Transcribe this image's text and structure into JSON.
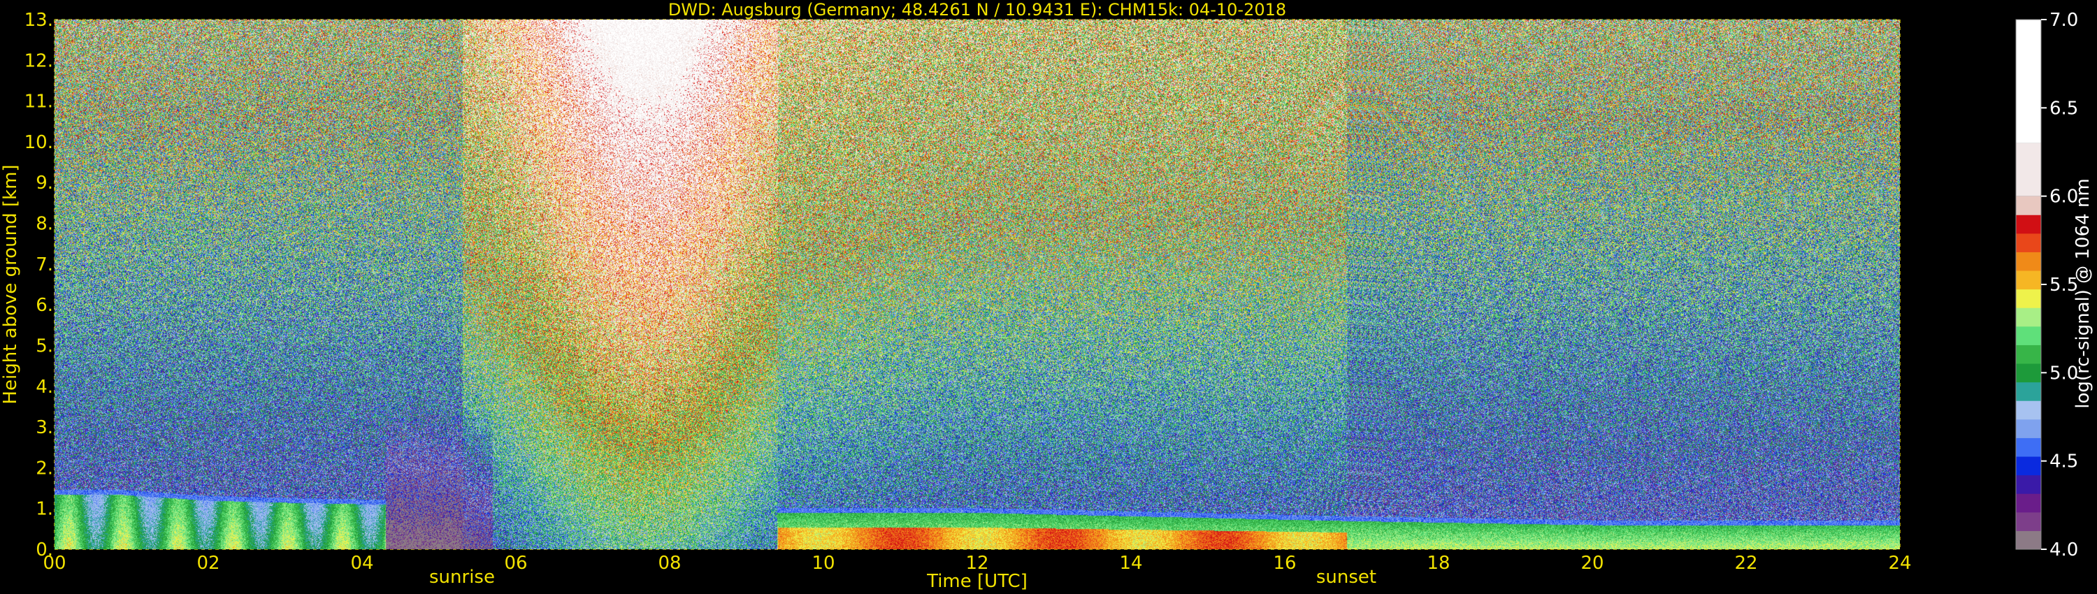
{
  "chart_data": {
    "type": "heatmap",
    "title": "DWD: Augsburg (Germany; 48.4261 N / 10.9431 E):    CHM15k: 04-10-2018",
    "xlabel": "Time [UTC]",
    "ylabel": "Height above ground [km]",
    "xlim": [
      0,
      24
    ],
    "ylim": [
      0,
      13
    ],
    "x_ticks": [
      "00",
      "02",
      "04",
      "06",
      "08",
      "10",
      "12",
      "14",
      "16",
      "18",
      "20",
      "22",
      "24"
    ],
    "y_ticks": [
      "0.",
      "1.",
      "2.",
      "3.",
      "4.",
      "5.",
      "6.",
      "7.",
      "8.",
      "9.",
      "10.",
      "11.",
      "12.",
      "13."
    ],
    "grid": true,
    "sunrise_hour": 5.3,
    "sunset_hour": 16.8,
    "sunrise_label": "sunrise",
    "sunset_label": "sunset",
    "colorbar": {
      "label": "log(rc-signal) @ 1064 nm",
      "range": [
        4.0,
        7.0
      ],
      "tick_labels": [
        "4.0",
        "4.5",
        "5.0",
        "5.5",
        "6.0",
        "6.5",
        "7.0"
      ],
      "colors": [
        "#8c7a86",
        "#7d3e8a",
        "#6a1d8a",
        "#3a1aa8",
        "#0a2adf",
        "#3e6ef5",
        "#7fa2ee",
        "#a7c2f0",
        "#2ba39a",
        "#1d9a3a",
        "#37b548",
        "#5fe07a",
        "#a8ef86",
        "#eef24b",
        "#f6b624",
        "#f08a18",
        "#e9471a",
        "#d10f14",
        "#e8c8c0",
        "#f2e8e8",
        "#ffffff"
      ]
    },
    "boundary_layer": [
      {
        "hour": 0.0,
        "top_km": 1.35
      },
      {
        "hour": 0.8,
        "top_km": 1.35
      },
      {
        "hour": 2.0,
        "top_km": 1.2
      },
      {
        "hour": 3.0,
        "top_km": 1.15
      },
      {
        "hour": 4.3,
        "top_km": 1.1
      },
      {
        "hour": 9.4,
        "top_km": 0.9
      },
      {
        "hour": 12.0,
        "top_km": 0.9
      },
      {
        "hour": 16.8,
        "top_km": 0.7
      },
      {
        "hour": 20.0,
        "top_km": 0.6
      },
      {
        "hour": 24.0,
        "top_km": 0.6
      }
    ]
  }
}
